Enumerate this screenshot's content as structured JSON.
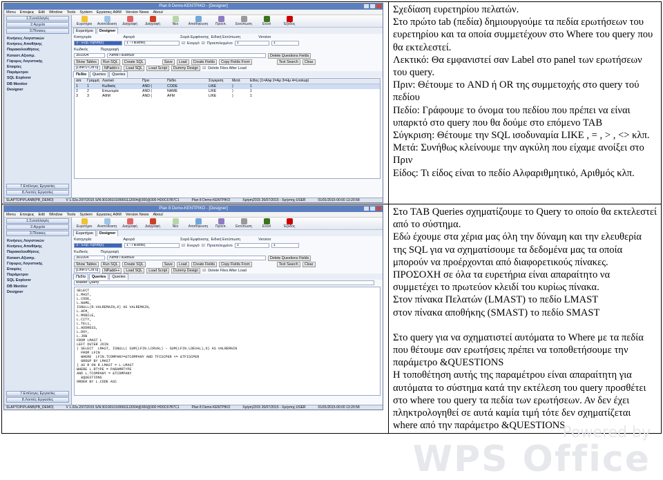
{
  "screens": [
    {
      "window_title": "Plan 8 Demo-ΚΕΝΤΡΙΚΟ - [Designer]",
      "menu": [
        "Menu",
        "Εποψεις",
        "Edit",
        "Window",
        "Tools",
        "System",
        "Εργασιες ΑΦΜ",
        "Version News",
        "About"
      ],
      "nav_buttons": [
        "1.Συναλλαγές",
        "2.Αρχεία",
        "3.Πίνακες"
      ],
      "nav_items": [
        "Κινήσεις Λογιστικών",
        "Κινήσεις Αποθήκης",
        "Παρακολουθήσεις",
        "Καταστ.Αξιοπρ.",
        "Γέφυρες Λογιστικής",
        "Εταιρίες",
        "Παράμετροι",
        "SQL Explorer",
        "DB Monitor",
        "Designer"
      ],
      "nav_bottom": [
        "7.Επίλογες Εργασίες",
        "8.Λοιπές Εργασίες"
      ],
      "toolbar": [
        "Ευρετήριο",
        "Αναπόδεικτη",
        "Διαγραφή",
        "Διάγραφή",
        "Νέο",
        "Αποθήκευση",
        "Προεπ.",
        "Εκτύπωση",
        "Excel",
        "Έξοδος"
      ],
      "tabs": [
        "Ευρετήριο",
        "Designer",
        "Πεδία"
      ],
      "form": {
        "category_label": "Κατηγορία",
        "category_value": "3 - Εύρ.Τύρνα(ε)",
        "view_label": "Αφορά",
        "view_value": "1 - Πελάτες",
        "active_label": "Ενεργό",
        "predefined_label": "Προεπιλεγμένο",
        "order_label": "Σειρά Εμφάνισης",
        "order_value": "1",
        "print_label": "Ειδική Εκτύπωση",
        "version_label": "Version",
        "version_value": "1",
        "code_label": "Κωδικός",
        "code_value": "301004",
        "desc_label": "Περιγραφή",
        "desc_value": "Λίστα Πελατών",
        "delete_fields_btn": "Delete Questions Fields"
      },
      "buttons": [
        "Show Tables",
        "Run SQL",
        "Create SQL",
        "Save",
        "Load",
        "Create Fields",
        "Copy Fields From"
      ],
      "buttons2": [
        "Load SQL",
        "Load Script",
        "Dummy Design",
        "Delete Files After Load"
      ],
      "text_search": "Text Search",
      "clear_btn": "Clear",
      "cursor_info": "[Line:0 Col:0]",
      "nparts": "NPadd++",
      "subtabs": [
        "Πεδία",
        "Queries",
        "Queries"
      ],
      "grid_head": [
        "α/α",
        "Γραμμή",
        "Λεκτικό",
        "Πριν",
        "Πεδίο",
        "Σύγκριση",
        "Μετά",
        "Είδος (1=Αλφ 2=Αρ 3=Ημ 4=Lookup)"
      ],
      "grid_rows": [
        [
          "1",
          "1",
          "Κωδικός",
          "AND (",
          "CODE",
          "LIKE",
          ")",
          "1"
        ],
        [
          "2",
          "2",
          "Επωνυμία",
          "AND (",
          "NAME",
          "LIKE",
          ")",
          "1"
        ],
        [
          "3",
          "3",
          "ΑΦΜ",
          "AND (",
          "AFM",
          "LIKE",
          ")",
          "1"
        ]
      ],
      "status": [
        "SLAPTOP\\PLANB(PB_DEMO)",
        "V 1.02a 20/7/2015 S/N:3010010109991112004@300@300 HD0C67B7C1",
        "Plan 8 Demo-ΚΕΝΤΡΙΚΟ",
        "Χρήση2015 26/07/2015 - Χρήστης:USER",
        "01/01/2015-00:00 13:20:58"
      ]
    },
    {
      "window_title": "Plan 8 Demo-ΚΕΝΤΡΙΚΟ - [Designer]",
      "tabs": [
        "Ευρετήριο",
        "Designer"
      ],
      "subtabs": [
        "Πεδία",
        "Queries",
        "Queries"
      ],
      "sql_title": "Master Query",
      "sql_lines": [
        "SELECT",
        "L.MAST,",
        "L.CODE,",
        "L.NAME,",
        "ISNULL(R.VALREMAIN,0) AS VALREMAIN,",
        "L.AFM,",
        "L.MOBILE,",
        "L.CITY,",
        "L.TEL1,",
        "L.ADDRESS,",
        "L.DOY,",
        "L.JOB",
        "FROM LMAST L",
        "LEFT OUTER JOIN",
        "( SELECT  LMAST, ISNULL( SUM(LFIN.LCRVAL) - SUM(LFIN.LDEVAL),0) AS VALREMAIN",
        "  FROM LFIN",
        "  WHERE  LFIN.TCOMPANY=&TCOMPANY AND TFISCPER <= &TFISCPER",
        "  GROUP BY LMAST",
        ") AS R ON R.LMAST = L.LMAST",
        "WHERE L.RTYPE = PARAMRTYPE",
        "AND L.TCOMPANY = &TCOMPANY",
        "  &QUESTIONS",
        "ORDER BY L.CODE ASC"
      ]
    }
  ],
  "desc1": [
    "Σχεδίαση ευρετηρίου πελατών.",
    "Στο πρώτο tab (πεδία) δημιουργούμε τα πεδία ερωτήσεων του ευρετηρίου και τα οποία συμμετέχουν στο Where του query που θα εκτελεστεί.",
    "Λεκτικό: Θα εμφανιστεί σαν Label στο panel των ερωτήσεων του query.",
    "Πριν: Θέτουμε το AND ή OR της συμμετοχής στο query τού πεδίου",
    "Πεδίο: Γράφουμε το όνομα του πεδίου που πρέπει να είναι υπαρκτό στο query που θα δούμε στο επόμενο TAB",
    "Σύγκριση: Θέτουμε την SQL ισοδυναμία LIKE , = , > , <> κλπ.",
    "Μετά: Συνήθως κλείνουμε την αγκύλη που είχαμε ανοίξει στο Πριν",
    "Είδος: Τι είδος είναι το πεδίο Αλφαριθμητικό, Αριθμός κλπ."
  ],
  "desc2a": [
    "Στο TAB Queries σχηματίζουμε το Query το οποίο θα εκτελεστεί από το σύστημα.",
    "Εδώ έχουμε στα χέρια μας όλη την δύναμη και την ελευθερία της SQL για να σχηματίσουμε τα δεδομένα μας τα οποία μπορούν να προέρχονται από διαφορετικούς πίνακες.",
    "ΠΡΟΣΟΧΗ σε όλα τα ευρετήρια είναι απαραίτητο να συμμετέχει το πρωτεύον κλειδί του κυρίως πίνακα.",
    "Στον πίνακα Πελατών (LMAST) το πεδίο LMAST",
    "στον πίνακα αποθήκης (SMAST) το πεδίο SMAST"
  ],
  "desc2b": [
    "Στο query για να σχηματιστεί αυτόματα το Where με τα πεδία που θέτουμε σαν ερωτήσεις πρέπει να τοποθετήσουμε την παράμετρο &QUESTIONS",
    "Η τοποθέτηση αυτής της παραμέτρου είναι απαραίτητη για αυτόματα το σύστημα κατά την εκτέλεση του query προσθέτει στο where του query τα πεδία των ερωτήσεων. Αν δεν έχει πληκτρολογηθεί σε αυτά καμία τιμή τότε δεν σχηματίζεται where από την παράμετρο &QUESTIONS"
  ],
  "watermark": {
    "small": "Powered by",
    "big": "WPS Office"
  },
  "colors": {
    "titlebar": "#5b7fbf",
    "nav": "#dfe7f3",
    "watermark": "#e6e8ec"
  }
}
